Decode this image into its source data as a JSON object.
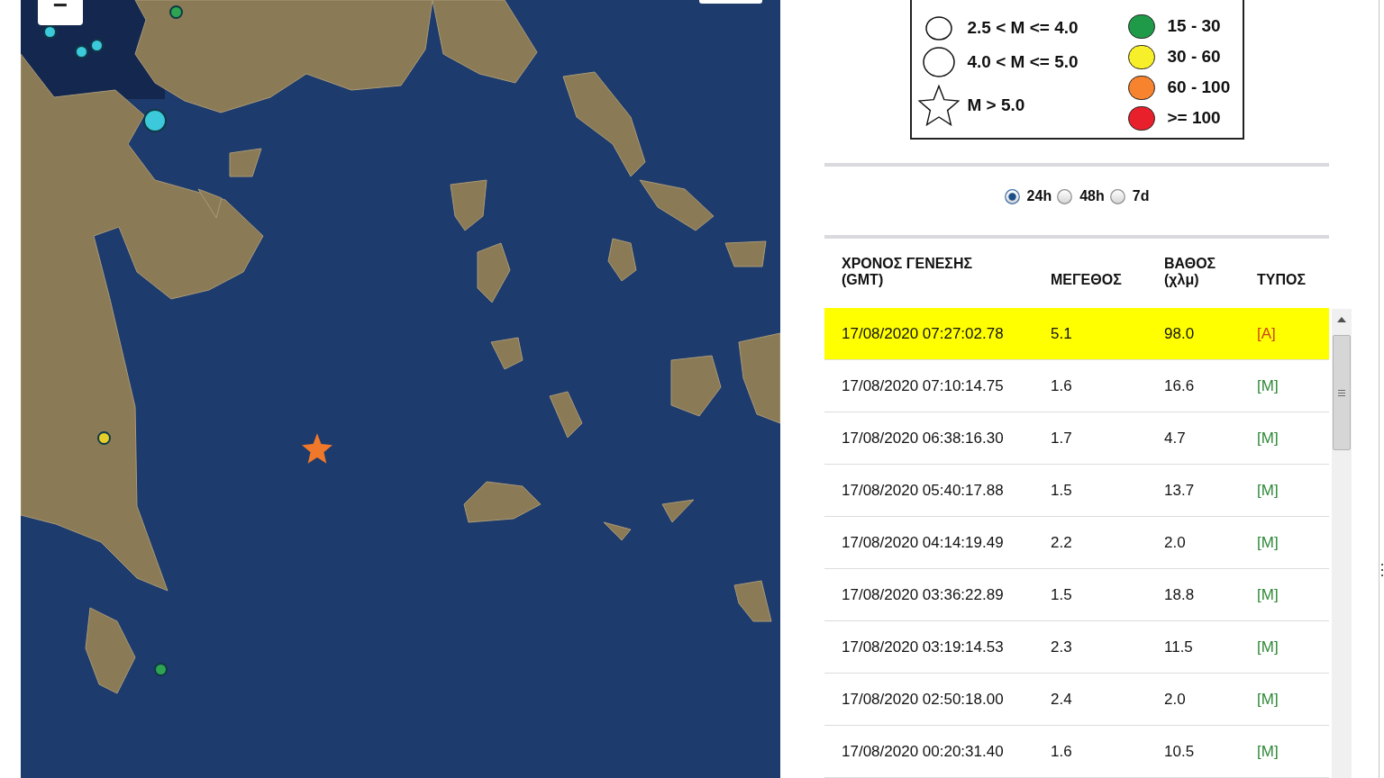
{
  "map": {
    "zoom_out_button": "−",
    "markers": [
      {
        "kind": "small",
        "color": "#2ea352"
      },
      {
        "kind": "small",
        "color": "#3cc9dc"
      },
      {
        "kind": "small",
        "color": "#3cc9dc"
      },
      {
        "kind": "small",
        "color": "#3cc9dc"
      },
      {
        "kind": "large",
        "color": "#3cc9dc"
      },
      {
        "kind": "small",
        "color": "#e6cf2a"
      },
      {
        "kind": "star",
        "color": "#f0782a"
      },
      {
        "kind": "small",
        "color": "#2ea352"
      }
    ]
  },
  "legend": {
    "magnitude": [
      {
        "kind": "medium",
        "label": "2.5 < M <= 4.0"
      },
      {
        "kind": "large",
        "label": "4.0 < M <= 5.0"
      },
      {
        "kind": "star",
        "label": "M > 5.0"
      }
    ],
    "depth": [
      {
        "label": "15 - 30",
        "color": "#1f9a48"
      },
      {
        "label": "30 - 60",
        "color": "#f7ef2a"
      },
      {
        "label": "60 - 100",
        "color": "#f7832e"
      },
      {
        "label": ">= 100",
        "color": "#e8202c"
      }
    ]
  },
  "period_options": [
    {
      "label": "24h",
      "selected": true
    },
    {
      "label": "48h",
      "selected": false
    },
    {
      "label": "7d",
      "selected": false
    }
  ],
  "table": {
    "columns": [
      "ΧΡΟΝΟΣ ΓΕΝΕΣΗΣ (GMT)",
      "ΜΕΓΕΘΟΣ",
      "ΒΑΘΟΣ (χλμ)",
      "ΤΥΠΟΣ"
    ],
    "rows": [
      {
        "time": "17/08/2020 07:27:02.78",
        "magnitude": "5.1",
        "depth": "98.0",
        "type": "[A]",
        "color": "#cc4418",
        "selected": true
      },
      {
        "time": "17/08/2020 07:10:14.75",
        "magnitude": "1.6",
        "depth": "16.6",
        "type": "[M]",
        "color": "#2f8a38",
        "selected": false
      },
      {
        "time": "17/08/2020 06:38:16.30",
        "magnitude": "1.7",
        "depth": "4.7",
        "type": "[M]",
        "color": "#2f8a38",
        "selected": false
      },
      {
        "time": "17/08/2020 05:40:17.88",
        "magnitude": "1.5",
        "depth": "13.7",
        "type": "[M]",
        "color": "#2f8a38",
        "selected": false
      },
      {
        "time": "17/08/2020 04:14:19.49",
        "magnitude": "2.2",
        "depth": "2.0",
        "type": "[M]",
        "color": "#2f8a38",
        "selected": false
      },
      {
        "time": "17/08/2020 03:36:22.89",
        "magnitude": "1.5",
        "depth": "18.8",
        "type": "[M]",
        "color": "#2f8a38",
        "selected": false
      },
      {
        "time": "17/08/2020 03:19:14.53",
        "magnitude": "2.3",
        "depth": "11.5",
        "type": "[M]",
        "color": "#2f8a38",
        "selected": false
      },
      {
        "time": "17/08/2020 02:50:18.00",
        "magnitude": "2.4",
        "depth": "2.0",
        "type": "[M]",
        "color": "#2f8a38",
        "selected": false
      },
      {
        "time": "17/08/2020 00:20:31.40",
        "magnitude": "1.6",
        "depth": "10.5",
        "type": "[M]",
        "color": "#2f8a38",
        "selected": false
      }
    ]
  }
}
